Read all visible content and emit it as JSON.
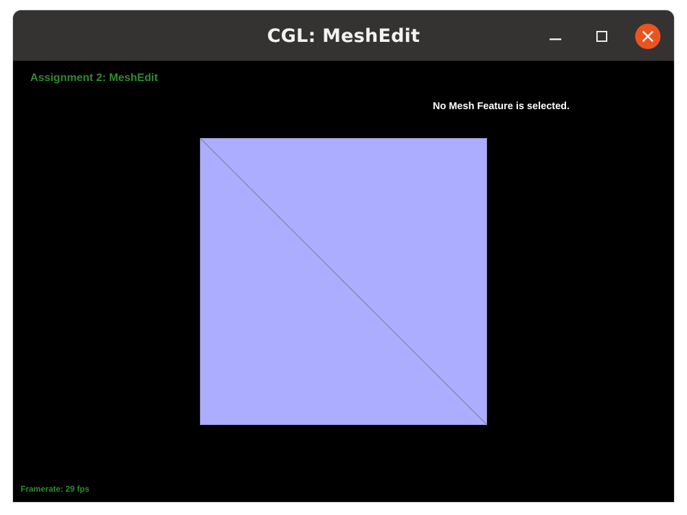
{
  "window": {
    "title": "CGL: MeshEdit",
    "buttons": {
      "minimize_icon": "minimize-icon",
      "maximize_icon": "maximize-icon",
      "close_icon": "close-icon"
    },
    "colors": {
      "titlebar": "#353232",
      "close_button": "#e95420"
    }
  },
  "hud": {
    "title": "Assignment 2: MeshEdit",
    "status": "No Mesh Feature is selected.",
    "framerate": "Framerate: 29 fps"
  },
  "mesh": {
    "face_color": "#adadff",
    "edge_color": "#7a7a9a"
  }
}
